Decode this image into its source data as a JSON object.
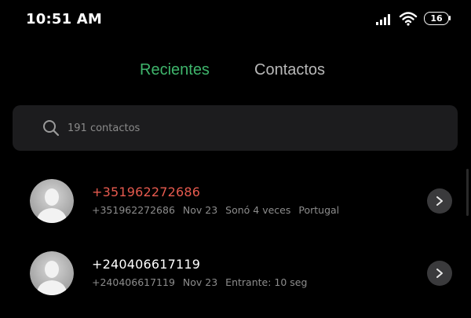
{
  "status_bar": {
    "time": "10:51 AM",
    "battery": "16",
    "icons": [
      "signal-icon",
      "wifi-icon",
      "battery-icon"
    ]
  },
  "tabs": [
    {
      "label": "Recientes",
      "active": true
    },
    {
      "label": "Contactos",
      "active": false
    }
  ],
  "search": {
    "placeholder": "191 contactos"
  },
  "calls": [
    {
      "number": "+351962272686",
      "missed": true,
      "detail_number": "+351962272686",
      "date": "Nov 23",
      "info": "Sonó 4 veces",
      "location": "Portugal"
    },
    {
      "number": "+240406617119",
      "missed": false,
      "detail_number": "+240406617119",
      "date": "Nov 23",
      "info": "Entrante: 10 seg",
      "location": ""
    }
  ],
  "colors": {
    "active_tab": "#3fb56c",
    "inactive_tab": "#b8b8b8",
    "missed_call": "#e65a4e",
    "background": "#000000",
    "search_bg": "#1c1c1e"
  }
}
